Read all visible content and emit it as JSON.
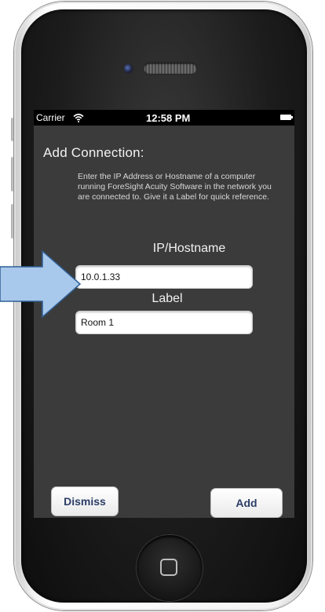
{
  "status_bar": {
    "carrier": "Carrier",
    "time": "12:58 PM"
  },
  "screen": {
    "title": "Add Connection:",
    "instructions": "Enter the IP Address or Hostname of a computer running ForeSight Acuity Software in the network you are connected to.  Give it a Label for quick reference.",
    "ip_field": {
      "label": "IP/Hostname",
      "value": "10.0.1.33"
    },
    "label_field": {
      "label": "Label",
      "value": "Room 1"
    },
    "buttons": {
      "dismiss": "Dismiss",
      "add": "Add"
    }
  },
  "icons": {
    "wifi": "wifi-icon",
    "battery": "battery-icon",
    "arrow": "arrow-right-icon",
    "home": "home-button-icon"
  },
  "colors": {
    "screen_bg": "#3b3b3b",
    "button_text": "#2b3d66",
    "arrow_fill": "#a9c9ec"
  }
}
